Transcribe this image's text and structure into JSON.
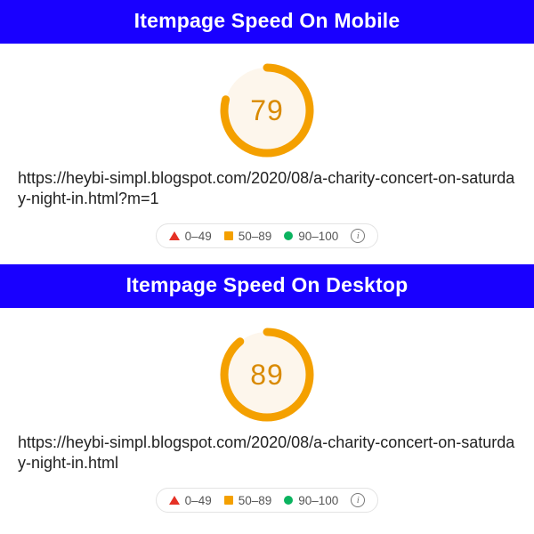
{
  "sections": [
    {
      "title": "Itempage Speed On Mobile",
      "score": 79,
      "url": "https://heybi-simpl.blogspot.com/2020/08/a-charity-concert-on-saturday-night-in.html?m=1"
    },
    {
      "title": "Itempage Speed On Desktop",
      "score": 89,
      "url": "https://heybi-simpl.blogspot.com/2020/08/a-charity-concert-on-saturday-night-in.html"
    }
  ],
  "legend": {
    "poor": "0–49",
    "average": "50–89",
    "good": "90–100"
  },
  "colors": {
    "header_bg": "#1900ff",
    "arc": "#f4a000",
    "gauge_fill": "#fdf6ec",
    "score_text": "#d98a00",
    "poor": "#e53125",
    "average": "#f4a000",
    "good": "#0bb35f"
  },
  "chart_data": [
    {
      "type": "pie",
      "title": "Itempage Speed On Mobile",
      "values": [
        79
      ],
      "ylim": [
        0,
        100
      ]
    },
    {
      "type": "pie",
      "title": "Itempage Speed On Desktop",
      "values": [
        89
      ],
      "ylim": [
        0,
        100
      ]
    }
  ]
}
